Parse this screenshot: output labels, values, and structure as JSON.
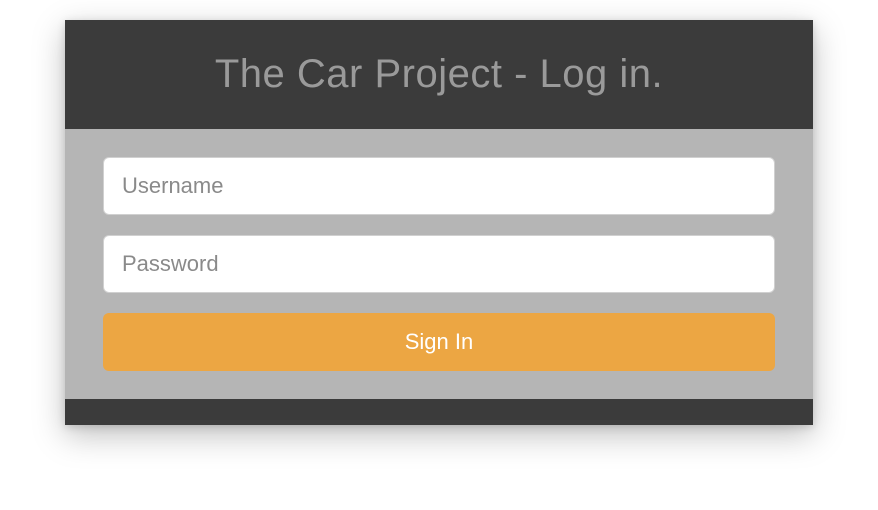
{
  "header": {
    "title": "The Car Project - Log in."
  },
  "form": {
    "username": {
      "placeholder": "Username",
      "value": ""
    },
    "password": {
      "placeholder": "Password",
      "value": ""
    },
    "submit_label": "Sign In"
  },
  "colors": {
    "accent": "#eca643",
    "header_bg": "#3b3b3b",
    "body_bg": "#b5b5b5"
  }
}
